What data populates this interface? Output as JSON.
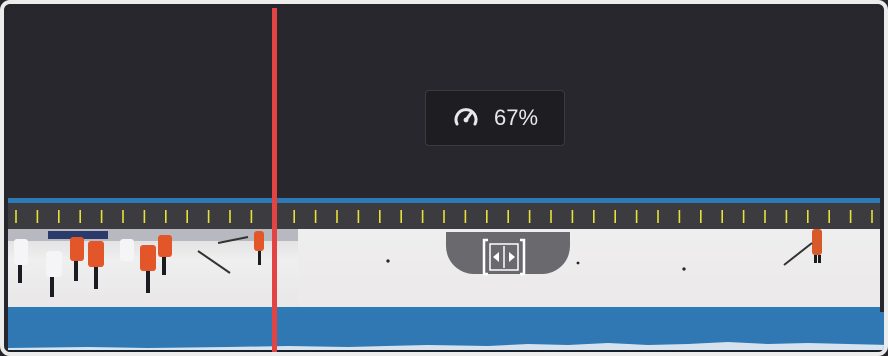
{
  "speed_badge": {
    "icon": "speedometer-icon",
    "value": "67%"
  },
  "colors": {
    "playhead": "#e24343",
    "clip": "#2d7ab5",
    "retime_ticks": "#e8e13a",
    "background": "#26262c"
  },
  "retime_handle": {
    "icon": "retime-handle-icon"
  }
}
